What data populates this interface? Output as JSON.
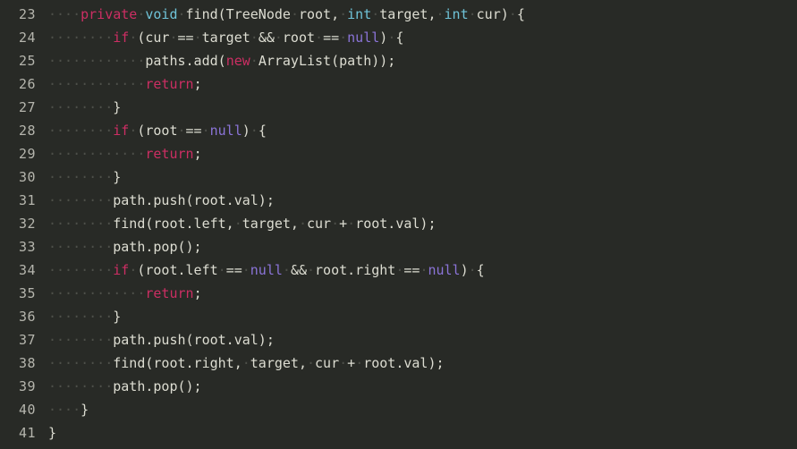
{
  "editor": {
    "language": "java",
    "theme": "dark",
    "background_color": "#282a26",
    "gutter_text_color": "#b5b5ad",
    "default_text_color": "#ddddd2",
    "whitespace_marker_color": "#4d4f49",
    "whitespace_marker_glyph": "·",
    "keyword_color": "#cc2e63",
    "type_color": "#6fc3d8",
    "literal_color": "#8b74d8",
    "first_line_number": 23,
    "last_line_number": 41,
    "lines": [
      {
        "number": "23",
        "text": "    private void find(TreeNode root, int target, int cur) {",
        "tokens": [
          {
            "t": "    ",
            "c": "ws"
          },
          {
            "t": "private",
            "c": "kw"
          },
          {
            "t": " ",
            "c": "ws"
          },
          {
            "t": "void",
            "c": "type"
          },
          {
            "t": " ",
            "c": "ws"
          },
          {
            "t": "find(TreeNode",
            "c": "txt"
          },
          {
            "t": " ",
            "c": "ws"
          },
          {
            "t": "root,",
            "c": "txt"
          },
          {
            "t": " ",
            "c": "ws"
          },
          {
            "t": "int",
            "c": "type"
          },
          {
            "t": " ",
            "c": "ws"
          },
          {
            "t": "target,",
            "c": "txt"
          },
          {
            "t": " ",
            "c": "ws"
          },
          {
            "t": "int",
            "c": "type"
          },
          {
            "t": " ",
            "c": "ws"
          },
          {
            "t": "cur)",
            "c": "txt"
          },
          {
            "t": " ",
            "c": "ws"
          },
          {
            "t": "{",
            "c": "txt"
          }
        ]
      },
      {
        "number": "24",
        "text": "        if (cur == target && root == null) {",
        "tokens": [
          {
            "t": "        ",
            "c": "ws"
          },
          {
            "t": "if",
            "c": "kw"
          },
          {
            "t": " ",
            "c": "ws"
          },
          {
            "t": "(cur",
            "c": "txt"
          },
          {
            "t": " ",
            "c": "ws"
          },
          {
            "t": "==",
            "c": "txt"
          },
          {
            "t": " ",
            "c": "ws"
          },
          {
            "t": "target",
            "c": "txt"
          },
          {
            "t": " ",
            "c": "ws"
          },
          {
            "t": "&&",
            "c": "txt"
          },
          {
            "t": " ",
            "c": "ws"
          },
          {
            "t": "root",
            "c": "txt"
          },
          {
            "t": " ",
            "c": "ws"
          },
          {
            "t": "==",
            "c": "txt"
          },
          {
            "t": " ",
            "c": "ws"
          },
          {
            "t": "null",
            "c": "nul"
          },
          {
            "t": ")",
            "c": "txt"
          },
          {
            "t": " ",
            "c": "ws"
          },
          {
            "t": "{",
            "c": "txt"
          }
        ]
      },
      {
        "number": "25",
        "text": "            paths.add(new ArrayList(path));",
        "tokens": [
          {
            "t": "            ",
            "c": "ws"
          },
          {
            "t": "paths.add(",
            "c": "txt"
          },
          {
            "t": "new",
            "c": "kw"
          },
          {
            "t": " ",
            "c": "ws"
          },
          {
            "t": "ArrayList(path));",
            "c": "txt"
          }
        ]
      },
      {
        "number": "26",
        "text": "            return;",
        "tokens": [
          {
            "t": "            ",
            "c": "ws"
          },
          {
            "t": "return",
            "c": "kw"
          },
          {
            "t": ";",
            "c": "txt"
          }
        ]
      },
      {
        "number": "27",
        "text": "        }",
        "tokens": [
          {
            "t": "        ",
            "c": "ws"
          },
          {
            "t": "}",
            "c": "txt"
          }
        ]
      },
      {
        "number": "28",
        "text": "        if (root == null) {",
        "tokens": [
          {
            "t": "        ",
            "c": "ws"
          },
          {
            "t": "if",
            "c": "kw"
          },
          {
            "t": " ",
            "c": "ws"
          },
          {
            "t": "(root",
            "c": "txt"
          },
          {
            "t": " ",
            "c": "ws"
          },
          {
            "t": "==",
            "c": "txt"
          },
          {
            "t": " ",
            "c": "ws"
          },
          {
            "t": "null",
            "c": "nul"
          },
          {
            "t": ")",
            "c": "txt"
          },
          {
            "t": " ",
            "c": "ws"
          },
          {
            "t": "{",
            "c": "txt"
          }
        ]
      },
      {
        "number": "29",
        "text": "            return;",
        "tokens": [
          {
            "t": "            ",
            "c": "ws"
          },
          {
            "t": "return",
            "c": "kw"
          },
          {
            "t": ";",
            "c": "txt"
          }
        ]
      },
      {
        "number": "30",
        "text": "        }",
        "tokens": [
          {
            "t": "        ",
            "c": "ws"
          },
          {
            "t": "}",
            "c": "txt"
          }
        ]
      },
      {
        "number": "31",
        "text": "        path.push(root.val);",
        "tokens": [
          {
            "t": "        ",
            "c": "ws"
          },
          {
            "t": "path.push(root.val);",
            "c": "txt"
          }
        ]
      },
      {
        "number": "32",
        "text": "        find(root.left, target, cur + root.val);",
        "tokens": [
          {
            "t": "        ",
            "c": "ws"
          },
          {
            "t": "find(root.left,",
            "c": "txt"
          },
          {
            "t": " ",
            "c": "ws"
          },
          {
            "t": "target,",
            "c": "txt"
          },
          {
            "t": " ",
            "c": "ws"
          },
          {
            "t": "cur",
            "c": "txt"
          },
          {
            "t": " ",
            "c": "ws"
          },
          {
            "t": "+",
            "c": "txt"
          },
          {
            "t": " ",
            "c": "ws"
          },
          {
            "t": "root.val);",
            "c": "txt"
          }
        ]
      },
      {
        "number": "33",
        "text": "        path.pop();",
        "tokens": [
          {
            "t": "        ",
            "c": "ws"
          },
          {
            "t": "path.pop();",
            "c": "txt"
          }
        ]
      },
      {
        "number": "34",
        "text": "        if (root.left == null && root.right == null) {",
        "tokens": [
          {
            "t": "        ",
            "c": "ws"
          },
          {
            "t": "if",
            "c": "kw"
          },
          {
            "t": " ",
            "c": "ws"
          },
          {
            "t": "(root.left",
            "c": "txt"
          },
          {
            "t": " ",
            "c": "ws"
          },
          {
            "t": "==",
            "c": "txt"
          },
          {
            "t": " ",
            "c": "ws"
          },
          {
            "t": "null",
            "c": "nul"
          },
          {
            "t": " ",
            "c": "ws"
          },
          {
            "t": "&&",
            "c": "txt"
          },
          {
            "t": " ",
            "c": "ws"
          },
          {
            "t": "root.right",
            "c": "txt"
          },
          {
            "t": " ",
            "c": "ws"
          },
          {
            "t": "==",
            "c": "txt"
          },
          {
            "t": " ",
            "c": "ws"
          },
          {
            "t": "null",
            "c": "nul"
          },
          {
            "t": ")",
            "c": "txt"
          },
          {
            "t": " ",
            "c": "ws"
          },
          {
            "t": "{",
            "c": "txt"
          }
        ]
      },
      {
        "number": "35",
        "text": "            return;",
        "tokens": [
          {
            "t": "            ",
            "c": "ws"
          },
          {
            "t": "return",
            "c": "kw"
          },
          {
            "t": ";",
            "c": "txt"
          }
        ]
      },
      {
        "number": "36",
        "text": "        }",
        "tokens": [
          {
            "t": "        ",
            "c": "ws"
          },
          {
            "t": "}",
            "c": "txt"
          }
        ]
      },
      {
        "number": "37",
        "text": "        path.push(root.val);",
        "tokens": [
          {
            "t": "        ",
            "c": "ws"
          },
          {
            "t": "path.push(root.val);",
            "c": "txt"
          }
        ]
      },
      {
        "number": "38",
        "text": "        find(root.right, target, cur + root.val);",
        "tokens": [
          {
            "t": "        ",
            "c": "ws"
          },
          {
            "t": "find(root.right,",
            "c": "txt"
          },
          {
            "t": " ",
            "c": "ws"
          },
          {
            "t": "target,",
            "c": "txt"
          },
          {
            "t": " ",
            "c": "ws"
          },
          {
            "t": "cur",
            "c": "txt"
          },
          {
            "t": " ",
            "c": "ws"
          },
          {
            "t": "+",
            "c": "txt"
          },
          {
            "t": " ",
            "c": "ws"
          },
          {
            "t": "root.val);",
            "c": "txt"
          }
        ]
      },
      {
        "number": "39",
        "text": "        path.pop();",
        "tokens": [
          {
            "t": "        ",
            "c": "ws"
          },
          {
            "t": "path.pop();",
            "c": "txt"
          }
        ]
      },
      {
        "number": "40",
        "text": "    }",
        "tokens": [
          {
            "t": "    ",
            "c": "ws"
          },
          {
            "t": "}",
            "c": "txt"
          }
        ]
      },
      {
        "number": "41",
        "text": "}",
        "tokens": [
          {
            "t": "}",
            "c": "txt"
          }
        ]
      }
    ]
  }
}
